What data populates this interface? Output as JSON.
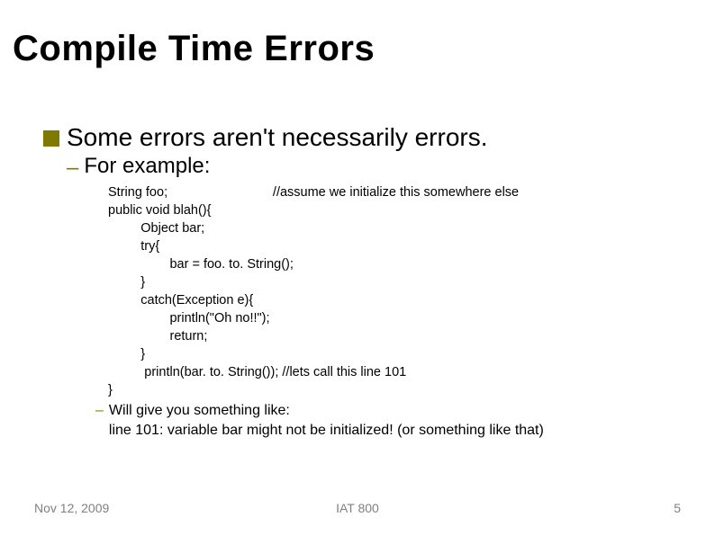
{
  "title": "Compile Time Errors",
  "bullet1": "Some errors aren't necessarily errors.",
  "subBullet1": "For example:",
  "code": "String foo;                             //assume we initialize this somewhere else\npublic void blah(){\n         Object bar;\n         try{\n                 bar = foo. to. String();\n         }\n         catch(Exception e){\n                 println(\"Oh no!!\");\n                 return;\n         }\n          println(bar. to. String()); //lets call this line 101\n}",
  "subBullet2": "Will give you something like:\nline 101:  variable bar might not be initialized! (or something like that)",
  "footer": {
    "date": "Nov 12, 2009",
    "center": "IAT 800",
    "page": "5"
  }
}
